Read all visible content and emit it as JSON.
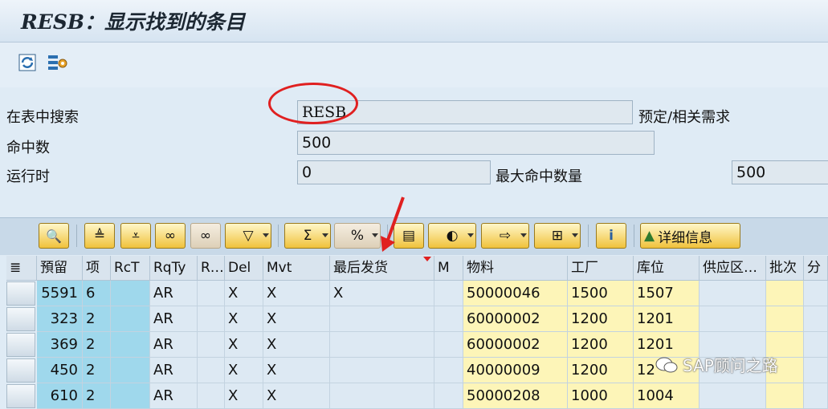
{
  "window": {
    "title": "RESB：显示找到的条目"
  },
  "toolbar": {
    "icons": [
      "refresh-icon",
      "settings-icon"
    ]
  },
  "form": {
    "search_table_label": "在表中搜索",
    "search_table_value": "RESB",
    "table_desc": "预定/相关需求",
    "hits_label": "命中数",
    "hits_value": "500",
    "runtime_label": "运行时",
    "runtime_value": "0",
    "max_hits_label": "最大命中数量",
    "max_hits_value": "500"
  },
  "alv": {
    "details_label": "详细信息"
  },
  "table": {
    "columns": [
      "預留",
      "项",
      "RcT",
      "RqTy",
      "R…",
      "Del",
      "Mvt",
      "最后发货",
      "M",
      "物料",
      "工厂",
      "库位",
      "供应区…",
      "批次",
      "分"
    ],
    "rows": [
      [
        "5591",
        "6",
        "",
        "AR",
        "",
        "X",
        "X",
        "X",
        "",
        "50000046",
        "1500",
        "1507",
        "",
        "",
        ""
      ],
      [
        "323",
        "2",
        "",
        "AR",
        "",
        "X",
        "X",
        "",
        "",
        "60000002",
        "1200",
        "1201",
        "",
        "",
        ""
      ],
      [
        "369",
        "2",
        "",
        "AR",
        "",
        "X",
        "X",
        "",
        "",
        "60000002",
        "1200",
        "1201",
        "",
        "",
        ""
      ],
      [
        "450",
        "2",
        "",
        "AR",
        "",
        "X",
        "X",
        "",
        "",
        "40000009",
        "1200",
        "12",
        "",
        "",
        ""
      ],
      [
        "610",
        "2",
        "",
        "AR",
        "",
        "X",
        "X",
        "",
        "",
        "50000208",
        "1000",
        "1004",
        "",
        "",
        ""
      ]
    ]
  },
  "watermark": {
    "text": "SAP顾问之路"
  },
  "colors": {
    "key_cyan": "#9fd8ec",
    "yellow_cell": "#fdf5b8",
    "annotation_red": "#e02020"
  }
}
